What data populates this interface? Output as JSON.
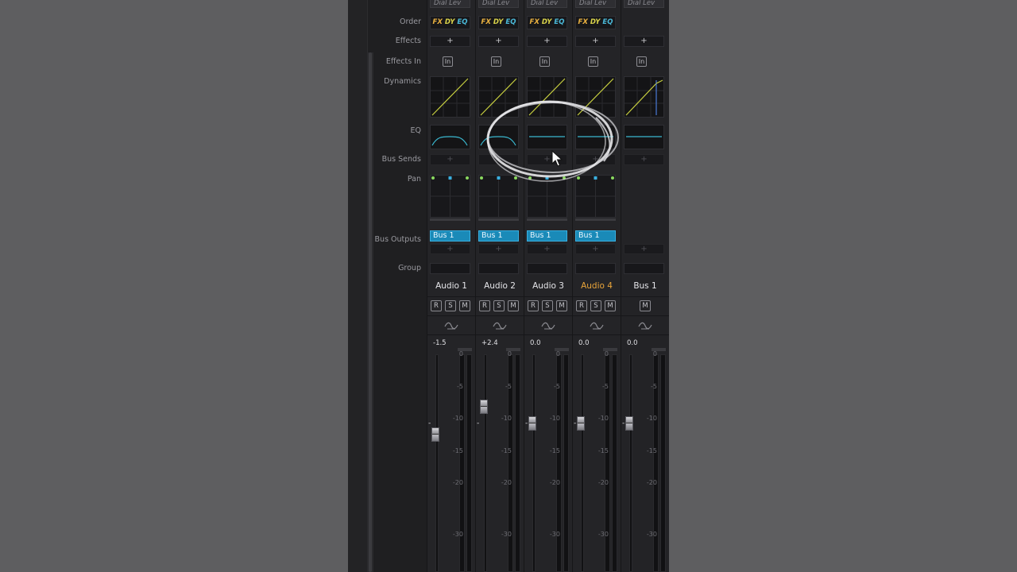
{
  "rows": {
    "order": "Order",
    "effects": "Effects",
    "effects_in": "Effects In",
    "dynamics": "Dynamics",
    "eq": "EQ",
    "bus_sends": "Bus Sends",
    "pan": "Pan",
    "bus_outputs": "Bus Outputs",
    "group": "Group"
  },
  "order_tokens": {
    "fx": "FX",
    "dy": "DY",
    "eq": "EQ"
  },
  "effects_add": "+",
  "bus_send_add": "+",
  "bus_output_add": "+",
  "effects_in_label": "In",
  "dial_label": "Dial Lev",
  "scale": [
    "0",
    "-5",
    "-10",
    "-15",
    "-20",
    "-30"
  ],
  "strips": [
    {
      "name": "Audio 1",
      "level": "-1.5",
      "bus_output": "Bus 1",
      "selected": false,
      "buttons": [
        "R",
        "S",
        "M"
      ]
    },
    {
      "name": "Audio 2",
      "level": "+2.4",
      "bus_output": "Bus 1",
      "selected": false,
      "buttons": [
        "R",
        "S",
        "M"
      ]
    },
    {
      "name": "Audio 3",
      "level": "0.0",
      "bus_output": "Bus 1",
      "selected": false,
      "buttons": [
        "R",
        "S",
        "M"
      ]
    },
    {
      "name": "Audio 4",
      "level": "0.0",
      "bus_output": "Bus 1",
      "selected": true,
      "buttons": [
        "R",
        "S",
        "M"
      ]
    },
    {
      "name": "Bus 1",
      "level": "0.0",
      "bus_output": "",
      "selected": false,
      "buttons": [
        "M"
      ]
    }
  ],
  "colors": {
    "accent_bus": "#1a8ab8",
    "selected_name": "#e8a43a",
    "dynamics_line": "#c8d040",
    "eq_line": "#3ab8d0",
    "pan_green": "#8ad860",
    "pan_blue": "#3ab0e0"
  },
  "icons": {
    "effects_in": "in-square-icon",
    "automation": "wave-icon",
    "cursor": "mouse-pointer-icon",
    "annotation": "hand-drawn-circle-annotation"
  }
}
